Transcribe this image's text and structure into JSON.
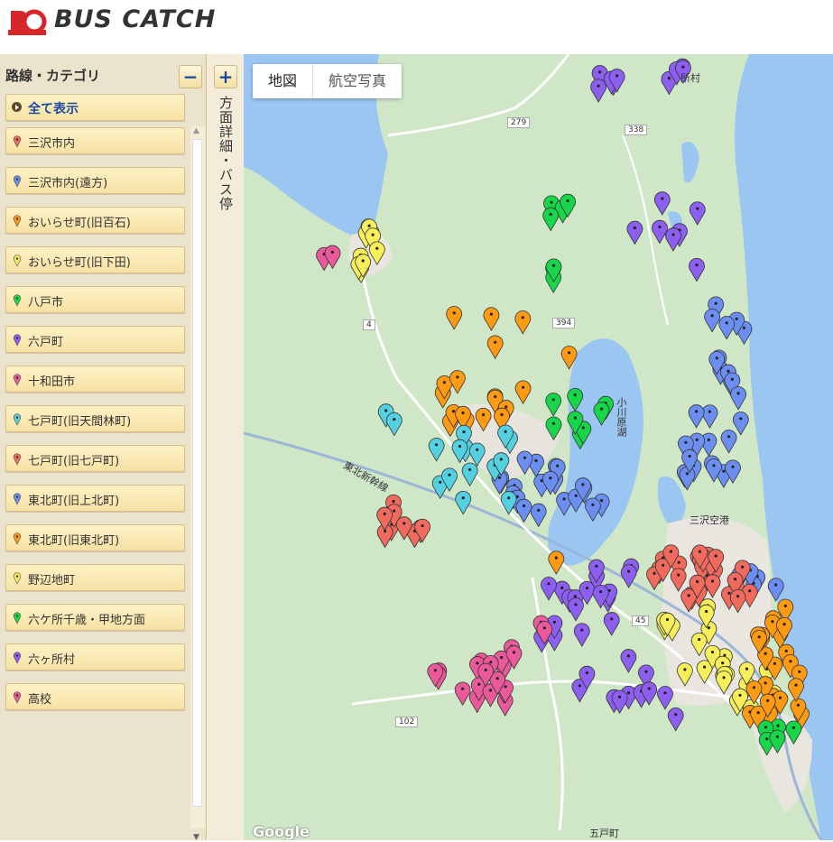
{
  "app": {
    "logo_text": "BUS CATCH",
    "logo_small": "BUS CATCH"
  },
  "sidebar": {
    "title": "路線・カテゴリ",
    "collapse_symbol": "−",
    "show_all": "全て表示",
    "categories": [
      {
        "label": "三沢市内",
        "color": "#f06a5e"
      },
      {
        "label": "三沢市内(遠方)",
        "color": "#6b8ef0"
      },
      {
        "label": "おいらせ町(旧百石)",
        "color": "#ff9a12"
      },
      {
        "label": "おいらせ町(旧下田)",
        "color": "#f7ef5a"
      },
      {
        "label": "八戸市",
        "color": "#18d64a"
      },
      {
        "label": "六戸町",
        "color": "#8c5ff0"
      },
      {
        "label": "十和田市",
        "color": "#ea5a9a"
      },
      {
        "label": "七戸町(旧天間林町)",
        "color": "#55d0e0"
      },
      {
        "label": "七戸町(旧七戸町)",
        "color": "#f06a5e"
      },
      {
        "label": "東北町(旧上北町)",
        "color": "#6b8ef0"
      },
      {
        "label": "東北町(旧東北町)",
        "color": "#ff9a12"
      },
      {
        "label": "野辺地町",
        "color": "#f7ef5a"
      },
      {
        "label": "六ケ所千歳・甲地方面",
        "color": "#18d64a"
      },
      {
        "label": "六ヶ所村",
        "color": "#8c5ff0"
      },
      {
        "label": "高校",
        "color": "#ea5a9a"
      }
    ]
  },
  "vtab": {
    "expand_symbol": "+",
    "label": "方面詳細・バス停"
  },
  "map": {
    "tabs": [
      "地図",
      "航空写真"
    ],
    "attribution": "Google",
    "labels": {
      "rokkasho": "所村",
      "misawa_airport": "三沢空港",
      "gonohe": "五戸町",
      "shinkansen": "東北新幹線",
      "ogawara": "小川原湖",
      "route_279": "279",
      "route_338": "338",
      "route_394": "394",
      "route_4": "4",
      "route_45": "45",
      "route_102": "102"
    }
  }
}
